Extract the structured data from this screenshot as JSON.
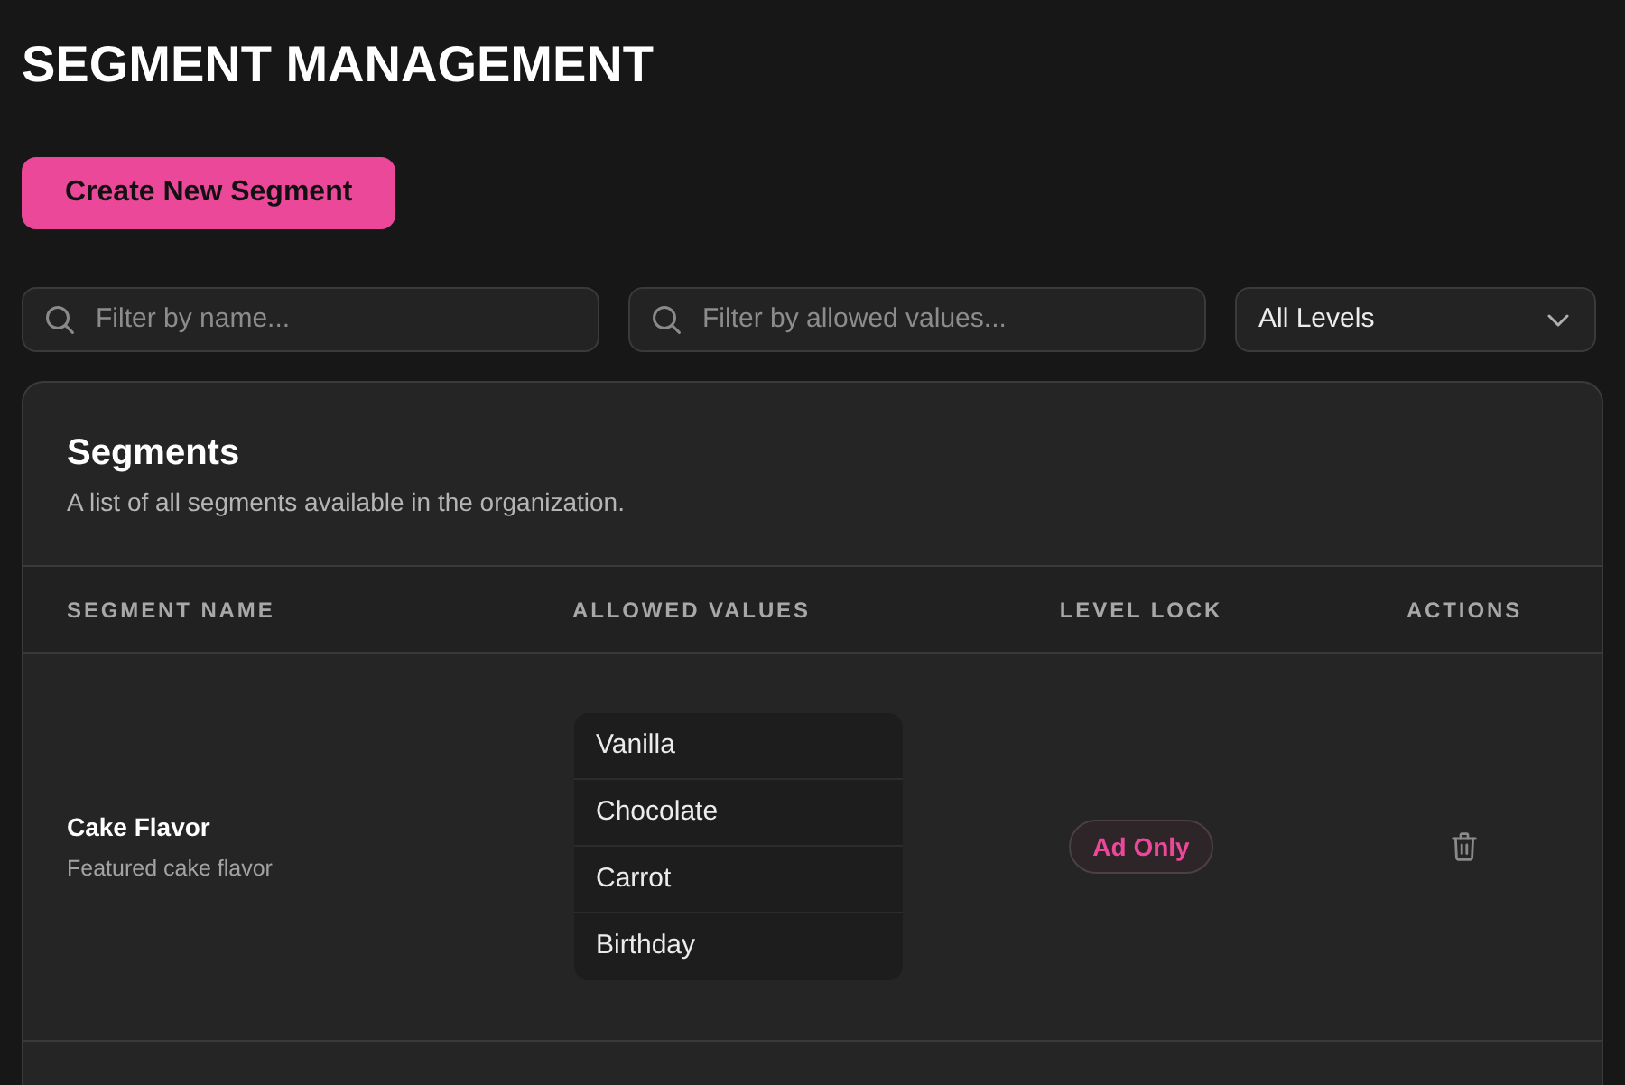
{
  "page": {
    "title": "SEGMENT MANAGEMENT"
  },
  "create_button": {
    "label": "Create New Segment"
  },
  "filters": [
    {
      "kind": "search",
      "placeholder": "Filter by name..."
    },
    {
      "kind": "search",
      "placeholder": "Filter by allowed values..."
    },
    {
      "kind": "select",
      "value": "All Levels"
    }
  ],
  "segments_card": {
    "title": "Segments",
    "description": "A list of all segments available in the organization.",
    "table": {
      "columns": [
        "SEGMENT NAME",
        "ALLOWED VALUES",
        "LEVEL LOCK",
        "ACTIONS"
      ],
      "rows": [
        {
          "name": "Cake Flavor",
          "description": "Featured cake flavor",
          "allowed_values": [
            "Vanilla",
            "Chocolate",
            "Carrot",
            "Birthday"
          ],
          "level_lock": "Ad Only"
        }
      ]
    }
  }
}
